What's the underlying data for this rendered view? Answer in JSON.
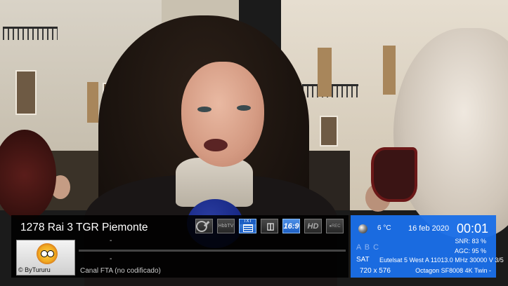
{
  "channel": {
    "title": "1278 Rai 3 TGR Piemonte",
    "now_event": "-",
    "next_event": "-",
    "progress_fraction": 0.0,
    "ca_status": "Canal FTA (no codificado)",
    "picon_label": "© ByTururu"
  },
  "icons": [
    {
      "name": "key-icon",
      "label": "",
      "active": false
    },
    {
      "name": "hbbtv-icon",
      "label": "HbbTV",
      "active": false
    },
    {
      "name": "txt-icon",
      "label": "TXT",
      "active": true
    },
    {
      "name": "dolby-icon",
      "label": "DD",
      "active": false
    },
    {
      "name": "aspect-169-icon",
      "label": "16:9",
      "active": true
    },
    {
      "name": "hd-icon",
      "label": "HD",
      "active": false
    },
    {
      "name": "rec-icon",
      "label": "●REC",
      "active": false
    }
  ],
  "panel": {
    "weather_icon": "moon-weather-icon",
    "temperature": "6 °C",
    "date": "16 feb 2020",
    "time": "00:01",
    "tuners": "A B C",
    "snr": "SNR:  83 %",
    "agc": "AGC:  95 %",
    "delivery": "SAT",
    "transponder": "Eutelsat 5 West A 11013.0 MHz 30000 V 3/5",
    "resolution": "720 x 576",
    "receiver": "Octagon SF8008 4K Twin -"
  },
  "colors": {
    "panel_blue": "#1a6ee8",
    "icon_active": "#1d5fc4",
    "infobar_bg": "#000000"
  }
}
